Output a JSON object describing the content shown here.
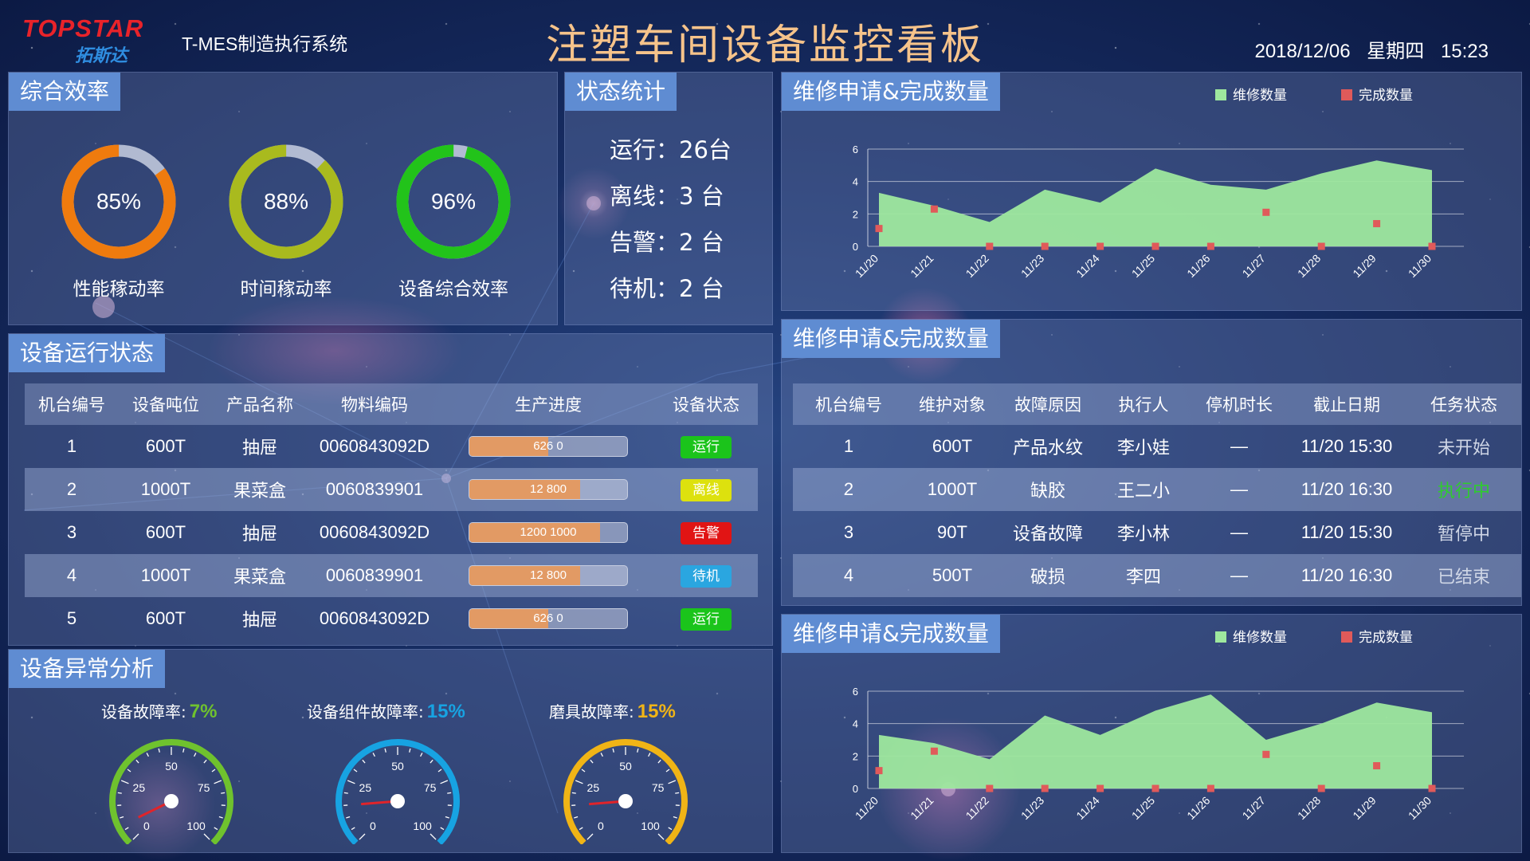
{
  "header": {
    "logo_text": "TOPSTAR",
    "logo_sub": "拓斯达",
    "system_name": "T-MES制造执行系统",
    "title": "注塑车间设备监控看板",
    "date": "2018/12/06",
    "weekday": "星期四",
    "time": "15:23"
  },
  "efficiency": {
    "title": "综合效率",
    "items": [
      {
        "value": "85%",
        "percent": 85,
        "label": "性能稼动率",
        "color": "#ef7b0e"
      },
      {
        "value": "88%",
        "percent": 88,
        "label": "时间稼动率",
        "color": "#a9ba1e"
      },
      {
        "value": "96%",
        "percent": 96,
        "label": "设备综合效率",
        "color": "#22c31a"
      }
    ]
  },
  "state_stats": {
    "title": "状态统计",
    "lines": [
      "运行：26台",
      "离线：3 台",
      "告警：2 台",
      "待机：2 台"
    ]
  },
  "equipment_status": {
    "title": "设备运行状态",
    "headers": [
      "机台编号",
      "设备吨位",
      "产品名称",
      "物料编码",
      "生产进度",
      "设备状态"
    ],
    "rows": [
      {
        "no": "1",
        "tonnage": "600T",
        "product": "抽屉",
        "code": "0060843092D",
        "progress_text": "626 0",
        "progress": 0.5,
        "status": "运行",
        "status_color": "#1bc41b"
      },
      {
        "no": "2",
        "tonnage": "1000T",
        "product": "果菜盒",
        "code": "0060839901",
        "progress_text": "12 800",
        "progress": 0.7,
        "status": "离线",
        "status_color": "#dde10e"
      },
      {
        "no": "3",
        "tonnage": "600T",
        "product": "抽屉",
        "code": "0060843092D",
        "progress_text": "1200 1000",
        "progress": 0.83,
        "status": "告警",
        "status_color": "#e11414"
      },
      {
        "no": "4",
        "tonnage": "1000T",
        "product": "果菜盒",
        "code": "0060839901",
        "progress_text": "12 800",
        "progress": 0.7,
        "status": "待机",
        "status_color": "#2aa6e0"
      },
      {
        "no": "5",
        "tonnage": "600T",
        "product": "抽屉",
        "code": "0060843092D",
        "progress_text": "626 0",
        "progress": 0.5,
        "status": "运行",
        "status_color": "#1bc41b"
      }
    ]
  },
  "anomaly": {
    "title": "设备异常分析",
    "gauges": [
      {
        "label": "设备故障率:",
        "value": "7%",
        "value_color": "#6fc22e",
        "arc_color": "#6fc22e",
        "needle_value": 7
      },
      {
        "label": "设备组件故障率:",
        "value": "15%",
        "value_color": "#17a3e2",
        "arc_color": "#17a3e2",
        "needle_value": 15
      },
      {
        "label": "磨具故障率:",
        "value": "15%",
        "value_color": "#f0b416",
        "arc_color": "#f0b416",
        "needle_value": 15
      }
    ],
    "scale": [
      "0",
      "25",
      "50",
      "75",
      "100"
    ]
  },
  "maintenance_table": {
    "title": "维修申请&完成数量",
    "headers": [
      "机台编号",
      "维护对象",
      "故障原因",
      "执行人",
      "停机时长",
      "截止日期",
      "任务状态"
    ],
    "rows": [
      {
        "no": "1",
        "target": "600T",
        "reason": "产品水纹",
        "person": "李小娃",
        "duration": "—",
        "deadline": "11/20 15:30",
        "state": "未开始",
        "state_color": "#cfd6e6"
      },
      {
        "no": "2",
        "target": "1000T",
        "reason": "缺胶",
        "person": "王二小",
        "duration": "—",
        "deadline": "11/20 16:30",
        "state": "执行中",
        "state_color": "#2ecc2e"
      },
      {
        "no": "3",
        "target": "90T",
        "reason": "设备故障",
        "person": "李小林",
        "duration": "—",
        "deadline": "11/20 15:30",
        "state": "暂停中",
        "state_color": "#cfd6e6"
      },
      {
        "no": "4",
        "target": "500T",
        "reason": "破损",
        "person": "李四",
        "duration": "—",
        "deadline": "11/20 16:30",
        "state": "已结束",
        "state_color": "#cfd6e6"
      }
    ]
  },
  "charts_meta": {
    "top_title": "维修申请&完成数量",
    "bottom_title": "维修申请&完成数量",
    "area_color": "#9ee89e",
    "point_color": "#e05a5a"
  },
  "chart_data": [
    {
      "type": "area",
      "title": "维修申请&完成数量",
      "categories": [
        "11/20",
        "11/21",
        "11/22",
        "11/23",
        "11/24",
        "11/25",
        "11/26",
        "11/27",
        "11/28",
        "11/29",
        "11/30"
      ],
      "series": [
        {
          "name": "维修数量",
          "type": "area",
          "values": [
            3.3,
            2.5,
            1.5,
            3.5,
            2.7,
            4.8,
            3.8,
            3.5,
            4.5,
            5.3,
            4.7
          ]
        },
        {
          "name": "完成数量",
          "type": "scatter",
          "values": [
            1.1,
            2.3,
            0,
            0,
            0,
            0,
            0,
            2.1,
            0,
            1.4,
            0
          ]
        }
      ],
      "ylim": [
        0,
        6
      ],
      "yticks": [
        0,
        2,
        4,
        6
      ],
      "legend": "top-right",
      "grid": true
    },
    {
      "type": "area",
      "title": "维修申请&完成数量",
      "categories": [
        "11/20",
        "11/21",
        "11/22",
        "11/23",
        "11/24",
        "11/25",
        "11/26",
        "11/27",
        "11/28",
        "11/29",
        "11/30"
      ],
      "series": [
        {
          "name": "维修数量",
          "type": "area",
          "values": [
            3.3,
            2.8,
            1.8,
            4.5,
            3.3,
            4.8,
            5.8,
            3.0,
            4.0,
            5.3,
            4.7
          ]
        },
        {
          "name": "完成数量",
          "type": "scatter",
          "values": [
            1.1,
            2.3,
            0,
            0,
            0,
            0,
            0,
            2.1,
            0,
            1.4,
            0
          ]
        }
      ],
      "ylim": [
        0,
        6
      ],
      "yticks": [
        0,
        2,
        4,
        6
      ],
      "legend": "top-right",
      "grid": true
    }
  ]
}
